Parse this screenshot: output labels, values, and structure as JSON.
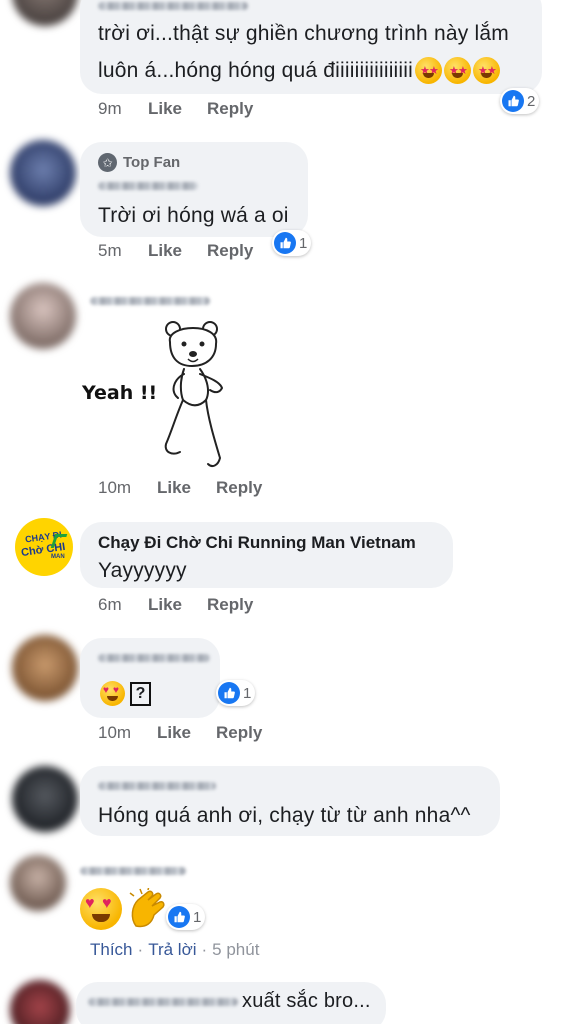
{
  "comments": [
    {
      "text_line1": "trời ơi...thật sự ghiền chương trình này lắm",
      "text_line2": "luôn á...hóng hóng quá điiiiiiiiiiiiiiii",
      "time": "9m",
      "like": "Like",
      "reply": "Reply",
      "reactions": "2"
    },
    {
      "badge": "Top Fan",
      "text": "Trời ơi hóng wá a oi",
      "time": "5m",
      "like": "Like",
      "reply": "Reply",
      "reactions": "1"
    },
    {
      "sticker_text": "Yeah !!",
      "time": "10m",
      "like": "Like",
      "reply": "Reply"
    },
    {
      "author": "Chạy Đi Chờ Chi Running Man Vietnam",
      "text": "Yayyyyyy",
      "time": "6m",
      "like": "Like",
      "reply": "Reply",
      "logo_text_top": "CHẠY ĐI",
      "logo_text_bottom": "Chờ CHI",
      "logo_text_man": "MAN"
    },
    {
      "unknown_glyph": "?",
      "time": "10m",
      "like": "Like",
      "reply": "Reply",
      "reactions": "1"
    },
    {
      "text": "Hóng quá anh ơi, chạy từ từ anh nha^^"
    },
    {
      "reactions": "1",
      "like": "Thích",
      "reply": "Trả lời",
      "time": "5 phút",
      "sep": "·"
    },
    {
      "text": "xuất sắc bro..."
    }
  ],
  "colors": {
    "bubble": "#f0f2f5",
    "like_blue": "#1877f2",
    "meta_gray": "#65676b",
    "link_blue": "#385898"
  }
}
